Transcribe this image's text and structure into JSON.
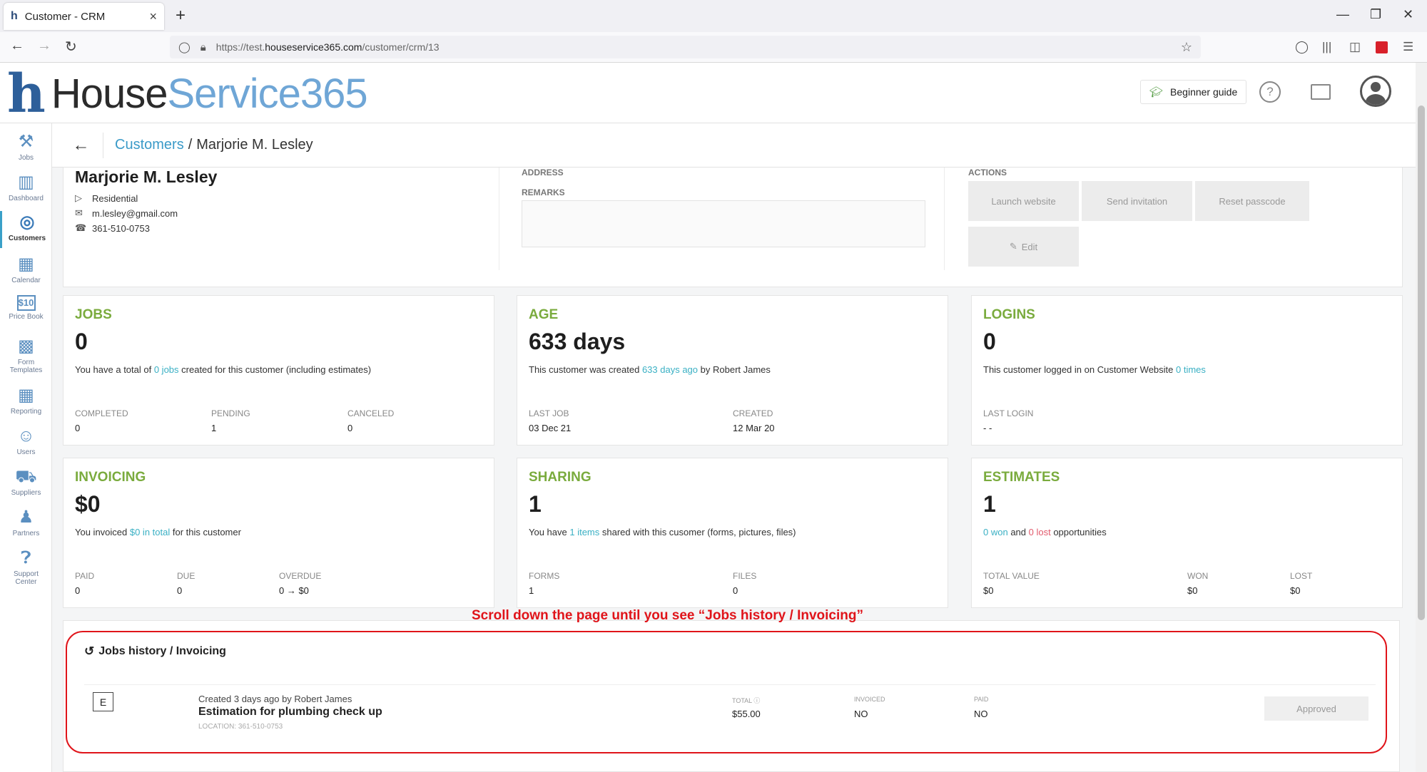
{
  "browser": {
    "tab_title": "Customer - CRM",
    "favicon_letter": "h",
    "tab_close": "×",
    "new_tab": "+",
    "url_prefix": "https://test.",
    "url_domain": "houseservice365.com",
    "url_path": "/customer/crm/13"
  },
  "header": {
    "logo_house": "House",
    "logo_service": "Service365",
    "beginner_guide": "Beginner guide"
  },
  "sidebar": {
    "items": [
      {
        "label": "Jobs",
        "icon": "tools-icon"
      },
      {
        "label": "Dashboard",
        "icon": "chart-icon"
      },
      {
        "label": "Customers",
        "icon": "target-icon"
      },
      {
        "label": "Calendar",
        "icon": "calendar-icon"
      },
      {
        "label": "Price Book",
        "icon": "price-tag-icon"
      },
      {
        "label": "Form",
        "label2": "Templates",
        "icon": "form-icon"
      },
      {
        "label": "Reporting",
        "icon": "report-icon"
      },
      {
        "label": "Users",
        "icon": "users-icon"
      },
      {
        "label": "Suppliers",
        "icon": "truck-icon"
      },
      {
        "label": "Partners",
        "icon": "partners-icon"
      },
      {
        "label": "Support",
        "label2": "Center",
        "icon": "support-icon"
      }
    ]
  },
  "breadcrumb": {
    "parent": "Customers",
    "separator": "/",
    "current": "Marjorie M. Lesley"
  },
  "customer": {
    "name": "Marjorie M. Lesley",
    "type": "Residential",
    "email": "m.lesley@gmail.com",
    "phone": "361-510-0753"
  },
  "profile_sections": {
    "address": "ADDRESS",
    "remarks": "REMARKS",
    "actions": "ACTIONS"
  },
  "actions": {
    "launch_website": "Launch website",
    "send_invitation": "Send invitation",
    "reset_passcode": "Reset passcode",
    "edit": "Edit"
  },
  "cards": {
    "jobs": {
      "title": "JOBS",
      "value": "0",
      "desc_pre": "You have a total of ",
      "desc_link": "0 jobs",
      "desc_post": " created for this customer (including estimates)",
      "stats": [
        {
          "label": "COMPLETED",
          "value": "0"
        },
        {
          "label": "PENDING",
          "value": "1"
        },
        {
          "label": "CANCELED",
          "value": "0"
        }
      ]
    },
    "age": {
      "title": "AGE",
      "value": "633 days",
      "desc_pre": "This customer was created ",
      "desc_link": "633 days ago",
      "desc_post": " by Robert James",
      "stats": [
        {
          "label": "LAST JOB",
          "value": "03 Dec 21"
        },
        {
          "label": "CREATED",
          "value": "12 Mar 20"
        }
      ]
    },
    "logins": {
      "title": "LOGINS",
      "value": "0",
      "desc_pre": "This customer logged in on Customer Website ",
      "desc_link": "0 times",
      "stats": [
        {
          "label": "LAST LOGIN",
          "value": "- -"
        }
      ]
    },
    "invoicing": {
      "title": "INVOICING",
      "value": "$0",
      "desc_pre": "You invoiced ",
      "desc_link": "$0 in total",
      "desc_post": " for this customer",
      "stats": [
        {
          "label": "PAID",
          "value": "0"
        },
        {
          "label": "DUE",
          "value": "0"
        },
        {
          "label": "OVERDUE",
          "value": "0 → $0"
        }
      ]
    },
    "sharing": {
      "title": "SHARING",
      "value": "1",
      "desc_pre": "You have ",
      "desc_link": "1 items",
      "desc_post": " shared with this cusomer (forms, pictures, files)",
      "stats": [
        {
          "label": "FORMS",
          "value": "1"
        },
        {
          "label": "FILES",
          "value": "0"
        }
      ]
    },
    "estimates": {
      "title": "ESTIMATES",
      "value": "1",
      "desc_link1": "0 won",
      "desc_mid": " and ",
      "desc_link2": "0 lost",
      "desc_post": " opportunities",
      "stats": [
        {
          "label": "TOTAL VALUE",
          "value": "$0"
        },
        {
          "label": "WON",
          "value": "$0"
        },
        {
          "label": "LOST",
          "value": "$0"
        }
      ]
    }
  },
  "annotation": "Scroll down the page until you see “Jobs history / Invoicing”",
  "history": {
    "title": "Jobs history / Invoicing",
    "job": {
      "type_letter": "E",
      "created": "Created 3 days ago by Robert James",
      "title": "Estimation for plumbing check up",
      "location": "LOCATION: 361-510-0753",
      "total_label": "TOTAL ⓘ",
      "total_value": "$55.00",
      "invoiced_label": "INVOICED",
      "invoiced_value": "NO",
      "paid_label": "PAID",
      "paid_value": "NO",
      "status": "Approved"
    }
  },
  "colors": {
    "accent_green": "#7aab3d",
    "link_teal": "#3ab0c4",
    "link_red": "#e2596b",
    "annotation_red": "#e0141a",
    "logo_blue": "#6fa6d6"
  }
}
